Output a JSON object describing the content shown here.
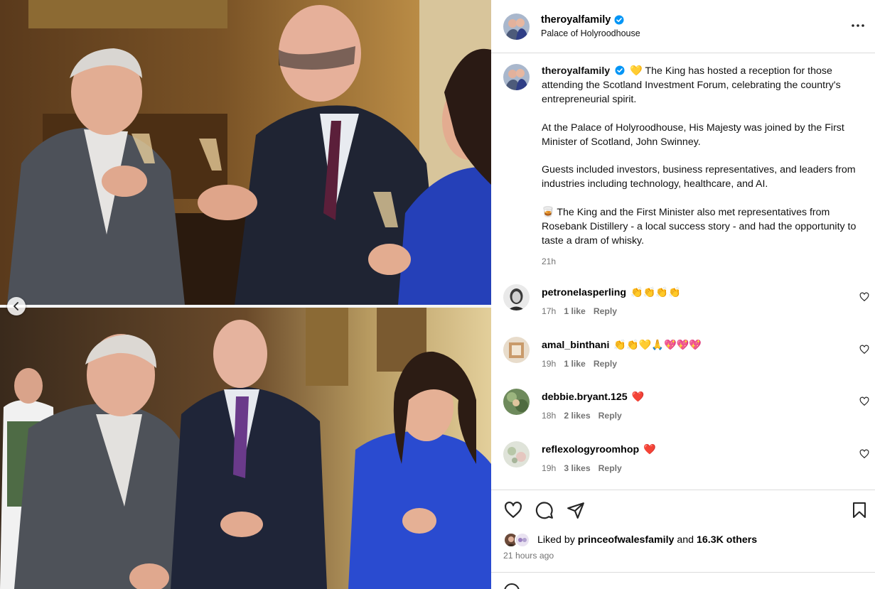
{
  "post": {
    "username": "theroyalfamily",
    "location": "Palace of Holyroodhouse",
    "caption_paragraphs": [
      "The King has hosted a reception for those attending the Scotland Investment Forum, celebrating the country's entrepreneurial spirit.",
      "At the Palace of Holyroodhouse, His Majesty was joined by the First Minister of Scotland, John Swinney.",
      "Guests included investors, business representatives, and leaders from industries including technology, healthcare, and AI.",
      "The King and the First Minister also met representatives from Rosebank Distillery - a local success story - and had the opportunity to taste a dram of whisky."
    ],
    "caption_first_emoji": "💛",
    "caption_last_emoji": "🥃",
    "caption_time": "21h"
  },
  "comments": [
    {
      "user": "petronelasperling",
      "text": "👏👏👏👏",
      "time": "17h",
      "likes": "1 like",
      "reply": "Reply"
    },
    {
      "user": "amal_binthani",
      "text": "👏👏💛🙏💖💖💖",
      "time": "19h",
      "likes": "1 like",
      "reply": "Reply"
    },
    {
      "user": "debbie.bryant.125",
      "text": "❤️",
      "time": "18h",
      "likes": "2 likes",
      "reply": "Reply"
    },
    {
      "user": "reflexologyroomhop",
      "text": "❤️",
      "time": "19h",
      "likes": "3 likes",
      "reply": "Reply"
    }
  ],
  "likes": {
    "prefix": "Liked by",
    "user": "princeofwalesfamily",
    "middle": "and",
    "count": "16.3K others"
  },
  "posted": "21 hours ago",
  "icons": {
    "more": "more-options-icon",
    "verified": "verified-badge-icon",
    "like": "heart-icon",
    "comment": "comment-icon",
    "share": "share-icon",
    "save": "bookmark-icon",
    "carousel_prev": "chevron-left-icon"
  },
  "colors": {
    "verified_blue": "#0095f6",
    "secondary_text": "#737373",
    "border": "#dbdbdb"
  }
}
